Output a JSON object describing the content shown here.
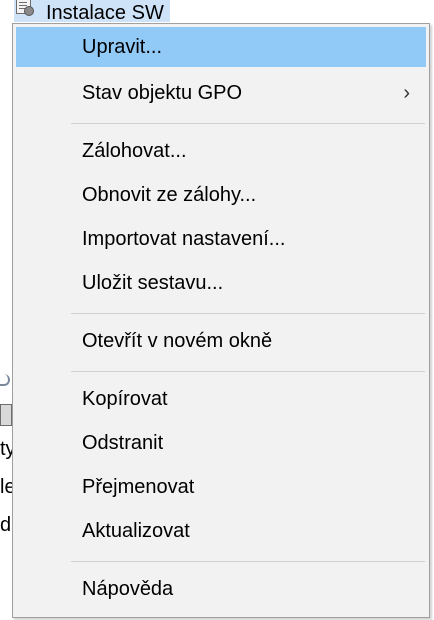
{
  "background": {
    "tree_item_label": "Instalace SW",
    "left_fragments": [
      "ty",
      "le",
      "dl"
    ]
  },
  "context_menu": {
    "items": [
      {
        "label": "Upravit...",
        "highlighted": true
      },
      {
        "label": "Stav objektu GPO",
        "has_submenu": true,
        "submenu_icon": "chevron-right-icon",
        "submenu_glyph": "›"
      },
      {
        "label": "Zálohovat..."
      },
      {
        "label": "Obnovit ze zálohy..."
      },
      {
        "label": "Importovat nastavení..."
      },
      {
        "label": "Uložit sestavu..."
      },
      {
        "label": "Otevřít v novém okně"
      },
      {
        "label": "Kopírovat"
      },
      {
        "label": "Odstranit"
      },
      {
        "label": "Přejmenovat"
      },
      {
        "label": "Aktualizovat"
      },
      {
        "label": "Nápověda"
      }
    ]
  },
  "colors": {
    "highlight": "#91c9f7",
    "menu_background": "#f2f2f2",
    "tree_selection": "#cfe3f8"
  }
}
